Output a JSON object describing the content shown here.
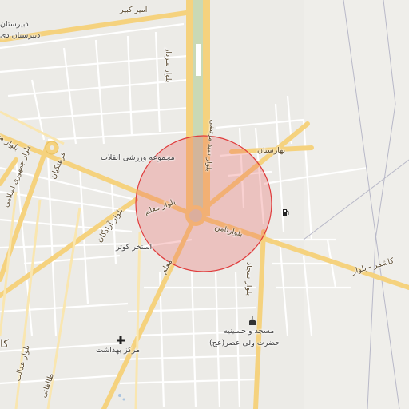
{
  "labels": {
    "amir_kabir": "امیر کبیر",
    "dabirestan": "دبیرستان",
    "dabirestan_2": "دبیرستان دی",
    "blvd_sardar": "بلوار سردار",
    "blvd_moallem_top": "بلوار معلم",
    "blvd_sayyad": "بلوار سید مرتضی",
    "baharestan": "بهارستان",
    "varzeshi": "مجموعه ورزشی انقلاب",
    "farhangian": "فرهنگیان",
    "blvd_jomhouri": "بلوار جمهوری اسلامی",
    "blvd_azadegan": "بلوار آزادگان",
    "blvd_moallem": "بلوار معلم",
    "blvd_samen": "بلوارثامن",
    "estakhr_kowsar": "استخر کوثر",
    "moallem_diag": "معلم",
    "blvd_sajjad": "بلوار سجاد",
    "kashmar": "کاشمر - بلوار",
    "masjed_line1": "مسجد و حسینیه",
    "masjed_line2": "حضرت ولی عصر(عج)",
    "markaz_behdasht": "مرکز بهداشت",
    "blvd_edalat": "بلوار عدالت",
    "taleghani": "طالقانی",
    "ka": "کا"
  },
  "icons": {
    "fuel": "fuel-station-icon",
    "health": "health-center-icon",
    "mosque": "mosque-icon"
  },
  "highlight": {
    "color": "#e03c3c",
    "fill": "rgba(235,90,90,0.28)"
  }
}
